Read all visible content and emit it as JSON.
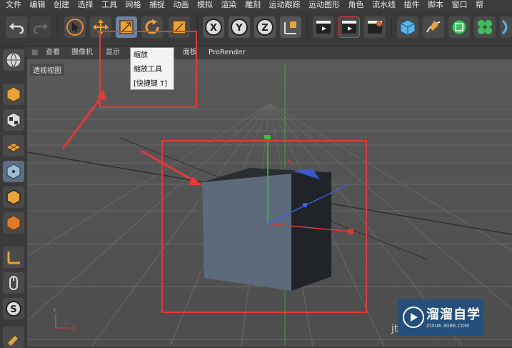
{
  "menubar": {
    "items": [
      "文件",
      "编辑",
      "创建",
      "选择",
      "工具",
      "网格",
      "捕捉",
      "动画",
      "模拟",
      "渲染",
      "雕刻",
      "运动跟踪",
      "运动图形",
      "角色",
      "流水线",
      "插件",
      "脚本",
      "窗口",
      "帮"
    ]
  },
  "viewport_menu": {
    "items": [
      "查看",
      "摄像机",
      "显示",
      "",
      "面板",
      "ProRender"
    ]
  },
  "viewport": {
    "label": "透视视图"
  },
  "tooltip": {
    "title": "缩放",
    "line2": "缩放工具",
    "line3": "[快捷键 T]"
  },
  "watermark": {
    "title": "溜溜自学",
    "subtitle": "ZIXUE.3066.COM",
    "partial_text": "jt"
  },
  "colors": {
    "red_highlight": "#e23a3a",
    "accent_blue": "#6b84a6",
    "axis_x": "#d83a3a",
    "axis_y": "#39c039",
    "axis_z": "#3a5ee0"
  },
  "icons": {
    "undo": "undo-icon",
    "redo": "redo-icon",
    "select": "select-arrow-icon",
    "move": "move-icon",
    "scale": "scale-icon",
    "rotate": "rotate-icon",
    "x_axis": "x-axis-icon",
    "y_axis": "y-axis-icon",
    "z_axis": "z-axis-icon"
  }
}
